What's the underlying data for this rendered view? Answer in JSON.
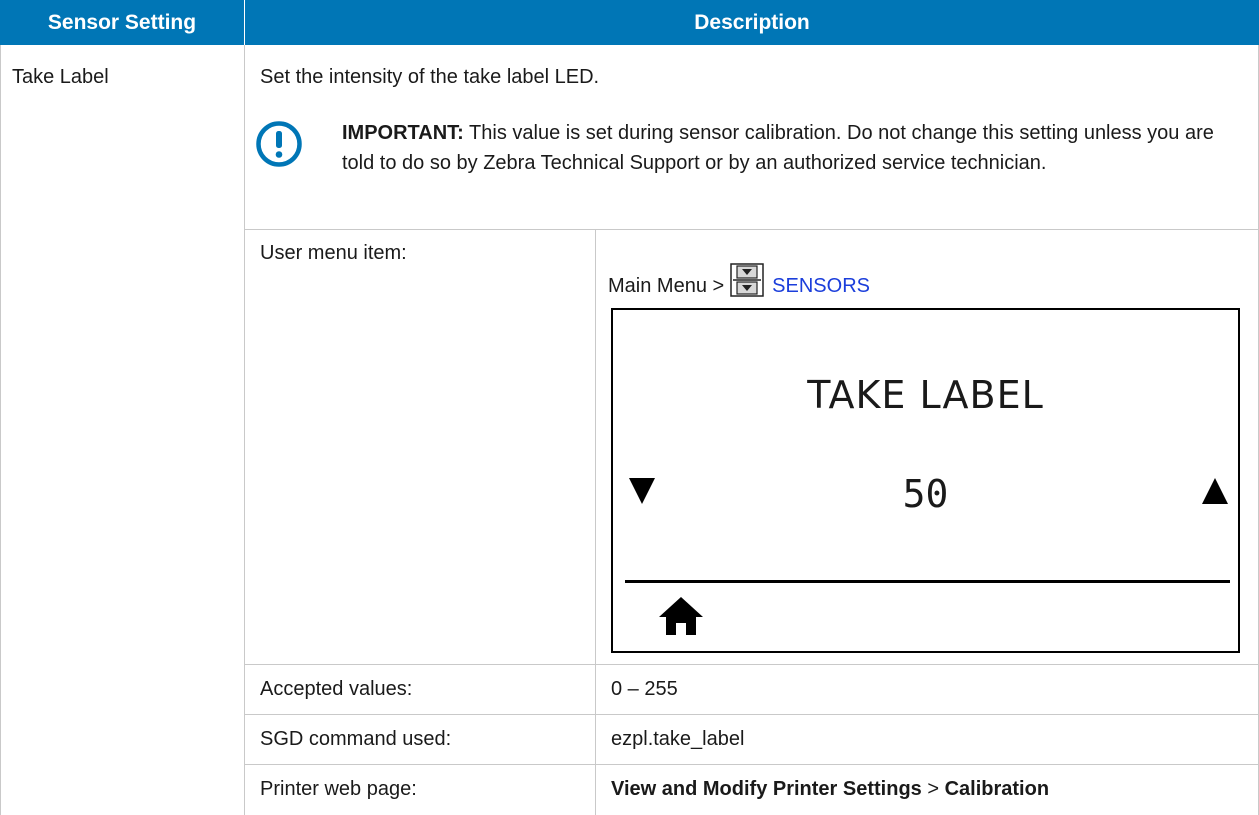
{
  "table": {
    "headers": [
      "Sensor Setting",
      "Description"
    ],
    "setting_name": "Take Label",
    "intro": "Set the intensity of the take label LED.",
    "important": {
      "label": "IMPORTANT:",
      "text": " This value is set during sensor calibration. Do not change this setting unless you are told to do so by Zebra Technical Support or by an authorized service technician."
    },
    "rows": {
      "user_menu": {
        "label": "User menu item:",
        "path_prefix": "Main Menu >",
        "path_link": "SENSORS"
      },
      "accepted": {
        "label": "Accepted values:",
        "value": "0 – 255"
      },
      "sgd": {
        "label": "SGD command used:",
        "value": "ezpl.take_label"
      },
      "web": {
        "label": "Printer web page:",
        "value_part1": "View and Modify Printer Settings",
        "separator": " > ",
        "value_part2": "Calibration"
      }
    }
  },
  "display": {
    "title": "TAKE LABEL",
    "value": "50"
  },
  "colors": {
    "header_bg": "#0076b6",
    "header_text": "#ffffff",
    "important_icon": "#0076b6",
    "link": "#1b3edb"
  },
  "icons": [
    "important-icon",
    "sensors-icon",
    "down-arrow-icon",
    "up-arrow-icon",
    "home-icon"
  ]
}
